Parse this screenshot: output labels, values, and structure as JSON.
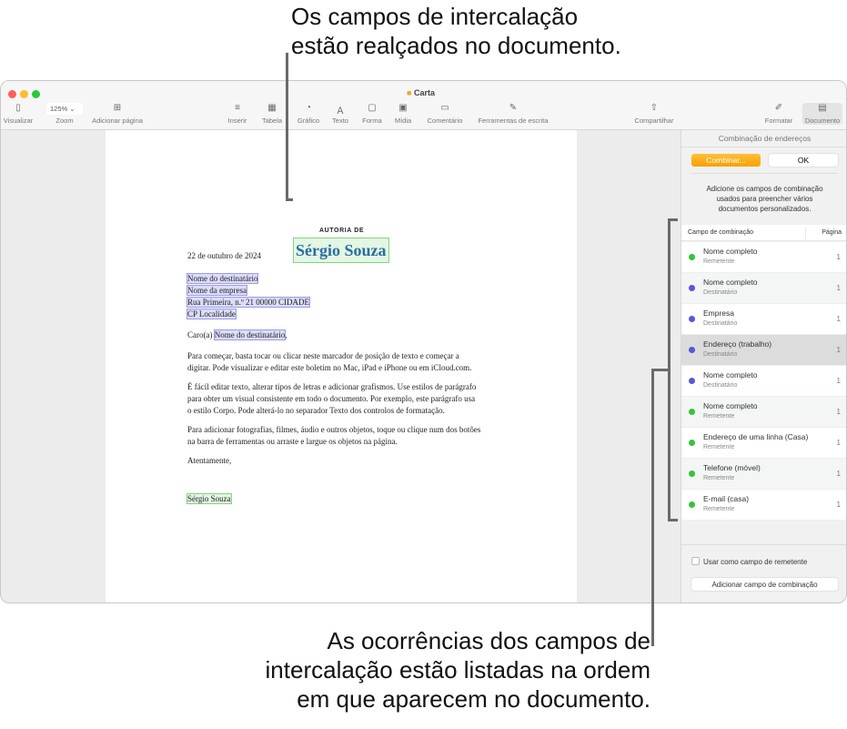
{
  "callouts": {
    "top": [
      "Os campos de intercalação",
      "estão realçados no documento."
    ],
    "bottom": [
      "As ocorrências dos campos de",
      "intercalação estão listadas na ordem",
      "em que aparecem no documento."
    ]
  },
  "window": {
    "title": "Carta"
  },
  "toolbar": {
    "zoom_value": "125%",
    "items": [
      {
        "label": "Visualizar",
        "icon": "sidebar-icon"
      },
      {
        "label": "Zoom"
      },
      {
        "label": "Adicionar página",
        "icon": "add-page-icon"
      },
      {
        "label": "Inserir",
        "icon": "insert-icon"
      },
      {
        "label": "Tabela",
        "icon": "table-icon"
      },
      {
        "label": "Gráfico",
        "icon": "chart-icon"
      },
      {
        "label": "Texto",
        "icon": "text-icon"
      },
      {
        "label": "Forma",
        "icon": "shape-icon"
      },
      {
        "label": "Mídia",
        "icon": "media-icon"
      },
      {
        "label": "Comentário",
        "icon": "comment-icon"
      },
      {
        "label": "Ferramentas de escrita",
        "icon": "writing-tools-icon"
      },
      {
        "label": "Compartilhar",
        "icon": "share-icon"
      },
      {
        "label": "Formatar",
        "icon": "format-icon"
      },
      {
        "label": "Documento",
        "icon": "document-icon"
      }
    ]
  },
  "document": {
    "byline": "AUTORIA DE",
    "author": "Sérgio Souza",
    "date": "22 de outubro de 2024",
    "address": [
      "Nome do destinatário",
      "Nome da empresa",
      "Rua Primeira, n.º 21 00000 CIDADE",
      "CP Localidade"
    ],
    "greeting_prefix": "Caro(a)",
    "greeting_field": "Nome do destinatário",
    "greeting_suffix": ",",
    "paragraphs": [
      [
        "Para começar, basta tocar ou clicar neste marcador de posição de texto e começar a",
        "digitar. Pode visualizar e editar este boletim no Mac, iPad e iPhone ou em iCloud.com."
      ],
      [
        "É fácil editar texto, alterar tipos de letras e adicionar grafismos. Use estilos de parágrafo",
        "para obter um visual consistente em todo o documento. Por exemplo, este parágrafo usa",
        "o estilo Corpo. Pode alterá-lo no separador Texto dos controlos de formatação."
      ],
      [
        "Para adicionar fotografias, filmes, áudio e outros objetos, toque ou clique num dos botões",
        "na barra de ferramentas ou arraste e largue os objetos na página."
      ]
    ],
    "closing": "Atentamente,",
    "signature": "Sérgio Souza"
  },
  "sidebar": {
    "title": "Combinação de endereços",
    "merge_button": "Combinar...",
    "ok_button": "OK",
    "description": [
      "Adicione os campos de combinação",
      "usados para preencher vários",
      "documentos personalizados."
    ],
    "col_field": "Campo de combinação",
    "col_page": "Página",
    "rows": [
      {
        "name": "Nome completo",
        "source": "Remetente",
        "page": "1",
        "color": "#34c43a"
      },
      {
        "name": "Nome completo",
        "source": "Destinatário",
        "page": "1",
        "color": "#5856d6"
      },
      {
        "name": "Empresa",
        "source": "Destinatário",
        "page": "1",
        "color": "#5856d6"
      },
      {
        "name": "Endereço (trabalho)",
        "source": "Destinatário",
        "page": "1",
        "color": "#5856d6"
      },
      {
        "name": "Nome completo",
        "source": "Destinatário",
        "page": "1",
        "color": "#5856d6"
      },
      {
        "name": "Nome completo",
        "source": "Remetente",
        "page": "1",
        "color": "#34c43a"
      },
      {
        "name": "Endereço de uma linha (Casa)",
        "source": "Remetente",
        "page": "1",
        "color": "#34c43a"
      },
      {
        "name": "Telefone (móvel)",
        "source": "Remetente",
        "page": "1",
        "color": "#34c43a"
      },
      {
        "name": "E-mail (casa)",
        "source": "Remetente",
        "page": "1",
        "color": "#34c43a"
      }
    ],
    "sender_checkbox": "Usar como campo de remetente",
    "add_field_button": "Adicionar campo de combinação"
  }
}
